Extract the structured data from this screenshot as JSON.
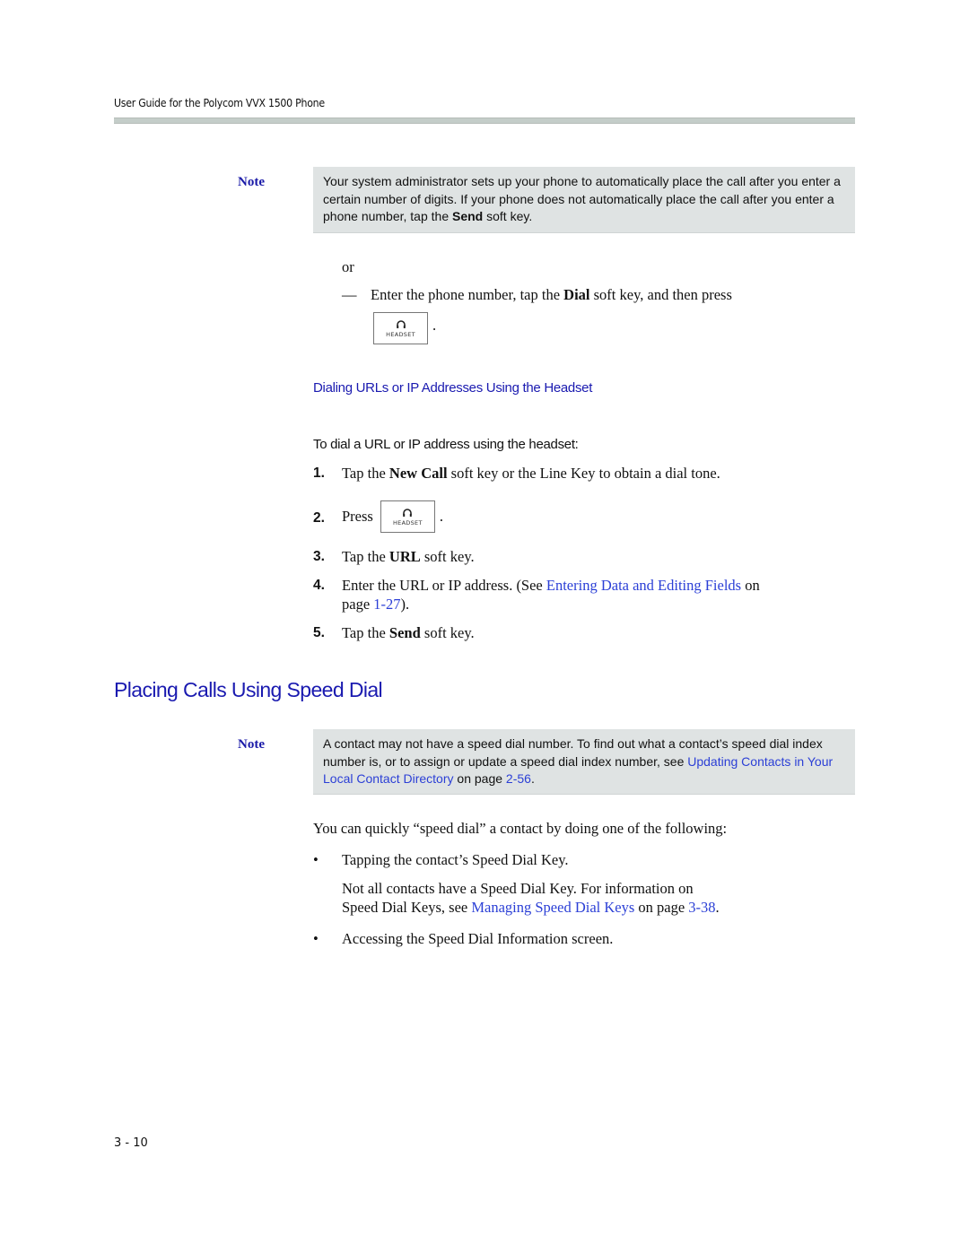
{
  "header": {
    "title": "User Guide for the Polycom VVX 1500 Phone"
  },
  "note1": {
    "label": "Note",
    "text_a": "Your system administrator sets up your phone to automatically place the call after you enter a certain number of digits. If your phone does not automatically place the call after you enter a phone number, tap the ",
    "bold": "Send",
    "text_b": " soft key."
  },
  "or_text": "or",
  "dash_item": {
    "marker": "—",
    "text_a": "Enter the phone number, tap the ",
    "bold": "Dial",
    "text_b": " soft key, and then press",
    "period": "."
  },
  "headset_key": {
    "label": "HEADSET",
    "icon": "headset-icon"
  },
  "subsection": {
    "title": "Dialing URLs or IP Addresses Using the Headset",
    "procedure_title": "To dial a URL or IP address using the headset:",
    "steps": [
      {
        "num": "1.",
        "text_a": "Tap the ",
        "bold": "New Call",
        "text_b": " soft key or the Line Key to obtain a dial tone."
      },
      {
        "num": "2.",
        "text_a": "Press",
        "period": "."
      },
      {
        "num": "3.",
        "text_a": "Tap the ",
        "bold": "URL",
        "text_b": " soft key."
      },
      {
        "num": "4.",
        "text_a": "Enter the URL or IP address. (See ",
        "link": "Entering Data and Editing Fields",
        "text_b": " on",
        "text_c": "page ",
        "page_link": "1-27",
        "text_d": ")."
      },
      {
        "num": "5.",
        "text_a": "Tap the ",
        "bold": "Send",
        "text_b": " soft key."
      }
    ]
  },
  "section": {
    "title": "Placing Calls Using Speed Dial"
  },
  "note2": {
    "label": "Note",
    "text_a": "A contact may not have a speed dial number. To find out what a contact’s speed dial index number is, or to assign or update a speed dial index number, see ",
    "link": "Updating Contacts in Your Local Contact Directory",
    "text_b": " on page ",
    "page_link": "2-56",
    "text_c": "."
  },
  "intro": "You can quickly “speed dial” a contact by doing one of the following:",
  "bullets": [
    {
      "marker": "•",
      "text": "Tapping the contact’s Speed Dial Key.",
      "sub_a": "Not all contacts have a Speed Dial Key. For information on",
      "sub_b": "Speed Dial Keys, see ",
      "link": "Managing Speed Dial Keys",
      "sub_c": " on page ",
      "page_link": "3-38",
      "sub_d": "."
    },
    {
      "marker": "•",
      "text": "Accessing the Speed Dial Information screen."
    }
  ],
  "footer": {
    "page_number": "3 - 10"
  },
  "colors": {
    "heading_blue": "#1a1ab0",
    "link_blue": "#2b3fd6",
    "note_bg": "#dfe3e3",
    "rule": "#c4cdc9"
  }
}
